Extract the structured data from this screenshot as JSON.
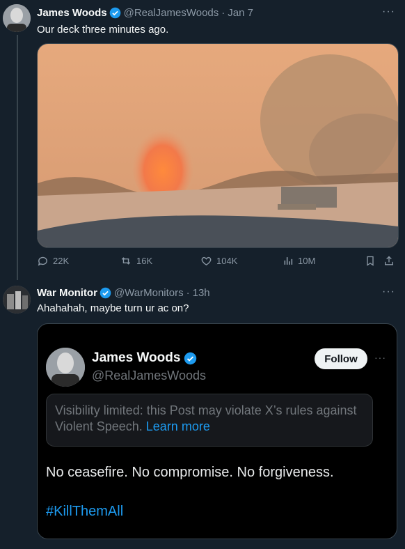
{
  "tweet1": {
    "name": "James Woods",
    "handle": "@RealJamesWoods",
    "separator": "·",
    "time": "Jan 7",
    "text": "Our deck three minutes ago.",
    "more": "···",
    "replies": "22K",
    "reposts": "16K",
    "likes": "104K",
    "views": "10M"
  },
  "tweet2": {
    "name": "War Monitor",
    "handle": "@WarMonitors",
    "separator": "·",
    "time": "13h",
    "text": "Ahahahah, maybe turn ur ac on?",
    "more": "···"
  },
  "quote": {
    "name": "James Woods",
    "handle": "@RealJamesWoods",
    "follow_label": "Follow",
    "more": "···",
    "notice_text": "Visibility limited: this Post may violate X’s rules against Violent Speech.",
    "notice_link": "Learn more",
    "text": "No ceasefire. No compromise. No forgiveness.",
    "hashtag": "#KillThemAll"
  },
  "colors": {
    "background": "#15202b",
    "verified": "#1d9bf0",
    "muted": "#8b98a5",
    "link": "#1d9bf0"
  }
}
